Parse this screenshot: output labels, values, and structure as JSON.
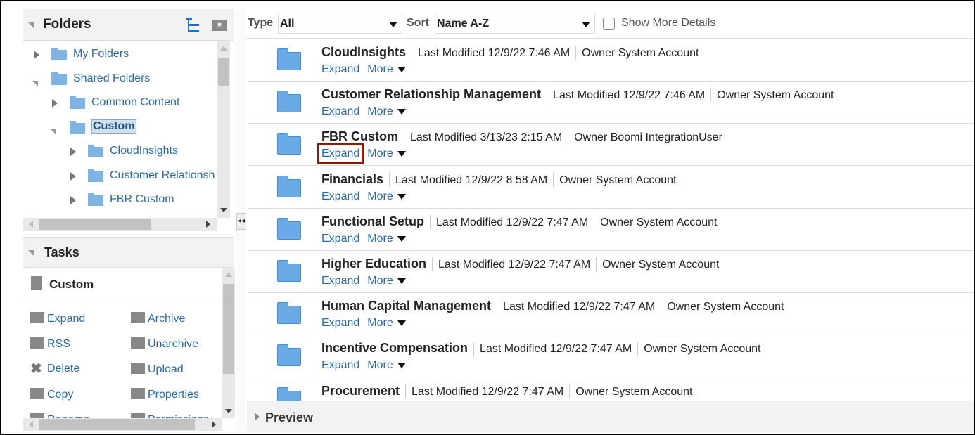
{
  "folders_panel": {
    "title": "Folders",
    "tree": [
      {
        "label": "My Folders",
        "state": "collapsed",
        "level": 0
      },
      {
        "label": "Shared Folders",
        "state": "expanded",
        "level": 0
      },
      {
        "label": "Common Content",
        "state": "collapsed",
        "level": 1
      },
      {
        "label": "Custom",
        "state": "expanded",
        "level": 1,
        "selected": true
      },
      {
        "label": "CloudInsights",
        "state": "collapsed",
        "level": 2
      },
      {
        "label": "Customer Relationsh",
        "state": "collapsed",
        "level": 2
      },
      {
        "label": "FBR Custom",
        "state": "collapsed",
        "level": 2
      }
    ]
  },
  "tasks_panel": {
    "title": "Tasks",
    "context": "Custom",
    "left": [
      "Expand",
      "RSS",
      "Delete",
      "Copy",
      "Rename"
    ],
    "right": [
      "Archive",
      "Unarchive",
      "Upload",
      "Properties",
      "Permissions"
    ]
  },
  "toolbar": {
    "type_label": "Type",
    "type_value": "All",
    "sort_label": "Sort",
    "sort_value": "Name A-Z",
    "show_more_label": "Show More Details",
    "show_more_checked": false
  },
  "items": [
    {
      "name": "CloudInsights",
      "modified": "Last Modified 12/9/22 7:46 AM",
      "owner": "Owner System Account"
    },
    {
      "name": "Customer Relationship Management",
      "modified": "Last Modified 12/9/22 7:46 AM",
      "owner": "Owner System Account"
    },
    {
      "name": "FBR Custom",
      "modified": "Last Modified 3/13/23 2:15 AM",
      "owner": "Owner Boomi IntegrationUser",
      "highlighted_action": "Expand"
    },
    {
      "name": "Financials",
      "modified": "Last Modified 12/9/22 8:58 AM",
      "owner": "Owner System Account"
    },
    {
      "name": "Functional Setup",
      "modified": "Last Modified 12/9/22 7:47 AM",
      "owner": "Owner System Account"
    },
    {
      "name": "Higher Education",
      "modified": "Last Modified 12/9/22 7:47 AM",
      "owner": "Owner System Account"
    },
    {
      "name": "Human Capital Management",
      "modified": "Last Modified 12/9/22 7:47 AM",
      "owner": "Owner System Account"
    },
    {
      "name": "Incentive Compensation",
      "modified": "Last Modified 12/9/22 7:47 AM",
      "owner": "Owner System Account"
    },
    {
      "name": "Procurement",
      "modified": "Last Modified 12/9/22 7:47 AM",
      "owner": "Owner System Account"
    }
  ],
  "actions": {
    "expand": "Expand",
    "more": "More"
  },
  "preview": {
    "title": "Preview"
  },
  "colors": {
    "link": "#2f6a9e",
    "highlight_box": "#8b1a0a",
    "folder": "#6aaae6"
  }
}
